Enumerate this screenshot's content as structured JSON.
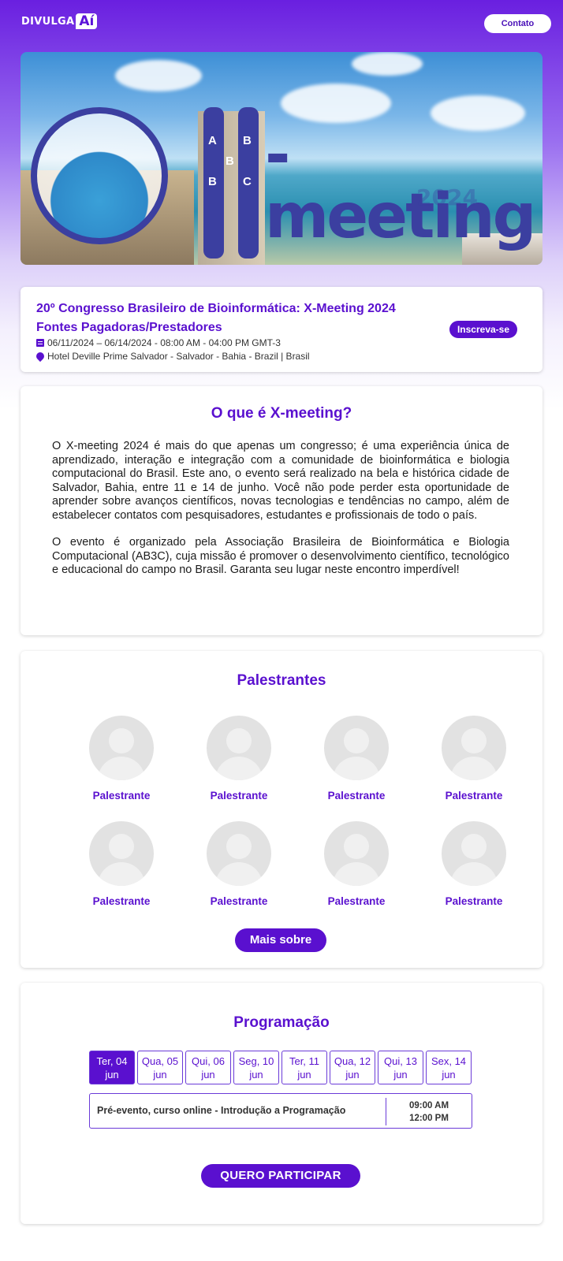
{
  "header": {
    "logo_text": "DIVULGA",
    "logo_badge": "Aí",
    "contact_label": "Contato"
  },
  "banner": {
    "logo_letters": [
      "A",
      "B",
      "B",
      "B",
      "C"
    ],
    "brand_text": "-meeting",
    "year_text": "2024"
  },
  "event": {
    "title_line1": "20º Congresso Brasileiro de Bioinformática: X-Meeting 2024",
    "title_line2": "Fontes Pagadoras/Prestadores",
    "date": "06/11/2024 – 06/14/2024 - 08:00 AM - 04:00 PM GMT-3",
    "location": "Hotel Deville Prime Salvador - Salvador - Bahia - Brazil | Brasil",
    "subscribe_label": "Inscreva-se"
  },
  "about": {
    "title": "O que é X-meeting?",
    "paragraph1": "O X-meeting 2024 é mais do que apenas um congresso; é uma experiência única de aprendizado, interação e integração com a comunidade de bioinformática e biologia computacional do Brasil. Este ano, o evento será realizado na bela e histórica cidade de Salvador, Bahia, entre 11 e 14 de junho. Você não pode perder esta oportunidade de aprender sobre avanços científicos, novas tecnologias e tendências no campo, além de estabelecer contatos com pesquisadores, estudantes e profissionais de todo o país.",
    "paragraph2": "O evento é organizado pela Associação Brasileira de Bioinformática e Biologia Computacional (AB3C), cuja missão é promover o desenvolvimento científico, tecnológico e educacional do campo no Brasil. Garanta seu lugar neste encontro imperdível!"
  },
  "speakers": {
    "title": "Palestrantes",
    "items": [
      {
        "name": "Palestrante"
      },
      {
        "name": "Palestrante"
      },
      {
        "name": "Palestrante"
      },
      {
        "name": "Palestrante"
      },
      {
        "name": "Palestrante"
      },
      {
        "name": "Palestrante"
      },
      {
        "name": "Palestrante"
      },
      {
        "name": "Palestrante"
      }
    ],
    "more_label": "Mais sobre"
  },
  "program": {
    "title": "Programação",
    "days": [
      {
        "day": "Ter, 04",
        "month": "jun",
        "active": true
      },
      {
        "day": "Qua, 05",
        "month": "jun",
        "active": false
      },
      {
        "day": "Qui, 06",
        "month": "jun",
        "active": false
      },
      {
        "day": "Seg, 10",
        "month": "jun",
        "active": false
      },
      {
        "day": "Ter, 11",
        "month": "jun",
        "active": false
      },
      {
        "day": "Qua, 12",
        "month": "jun",
        "active": false
      },
      {
        "day": "Qui, 13",
        "month": "jun",
        "active": false
      },
      {
        "day": "Sex, 14",
        "month": "jun",
        "active": false
      }
    ],
    "session": {
      "title": "Pré-evento, curso online - Introdução a Programação",
      "start": "09:00 AM",
      "end": "12:00 PM"
    },
    "cta_label": "QUERO PARTICIPAR"
  },
  "colors": {
    "accent": "#5a10cf",
    "header_gradient_top": "#6a1fe0",
    "placeholder_avatar": "#e2e2e2"
  }
}
